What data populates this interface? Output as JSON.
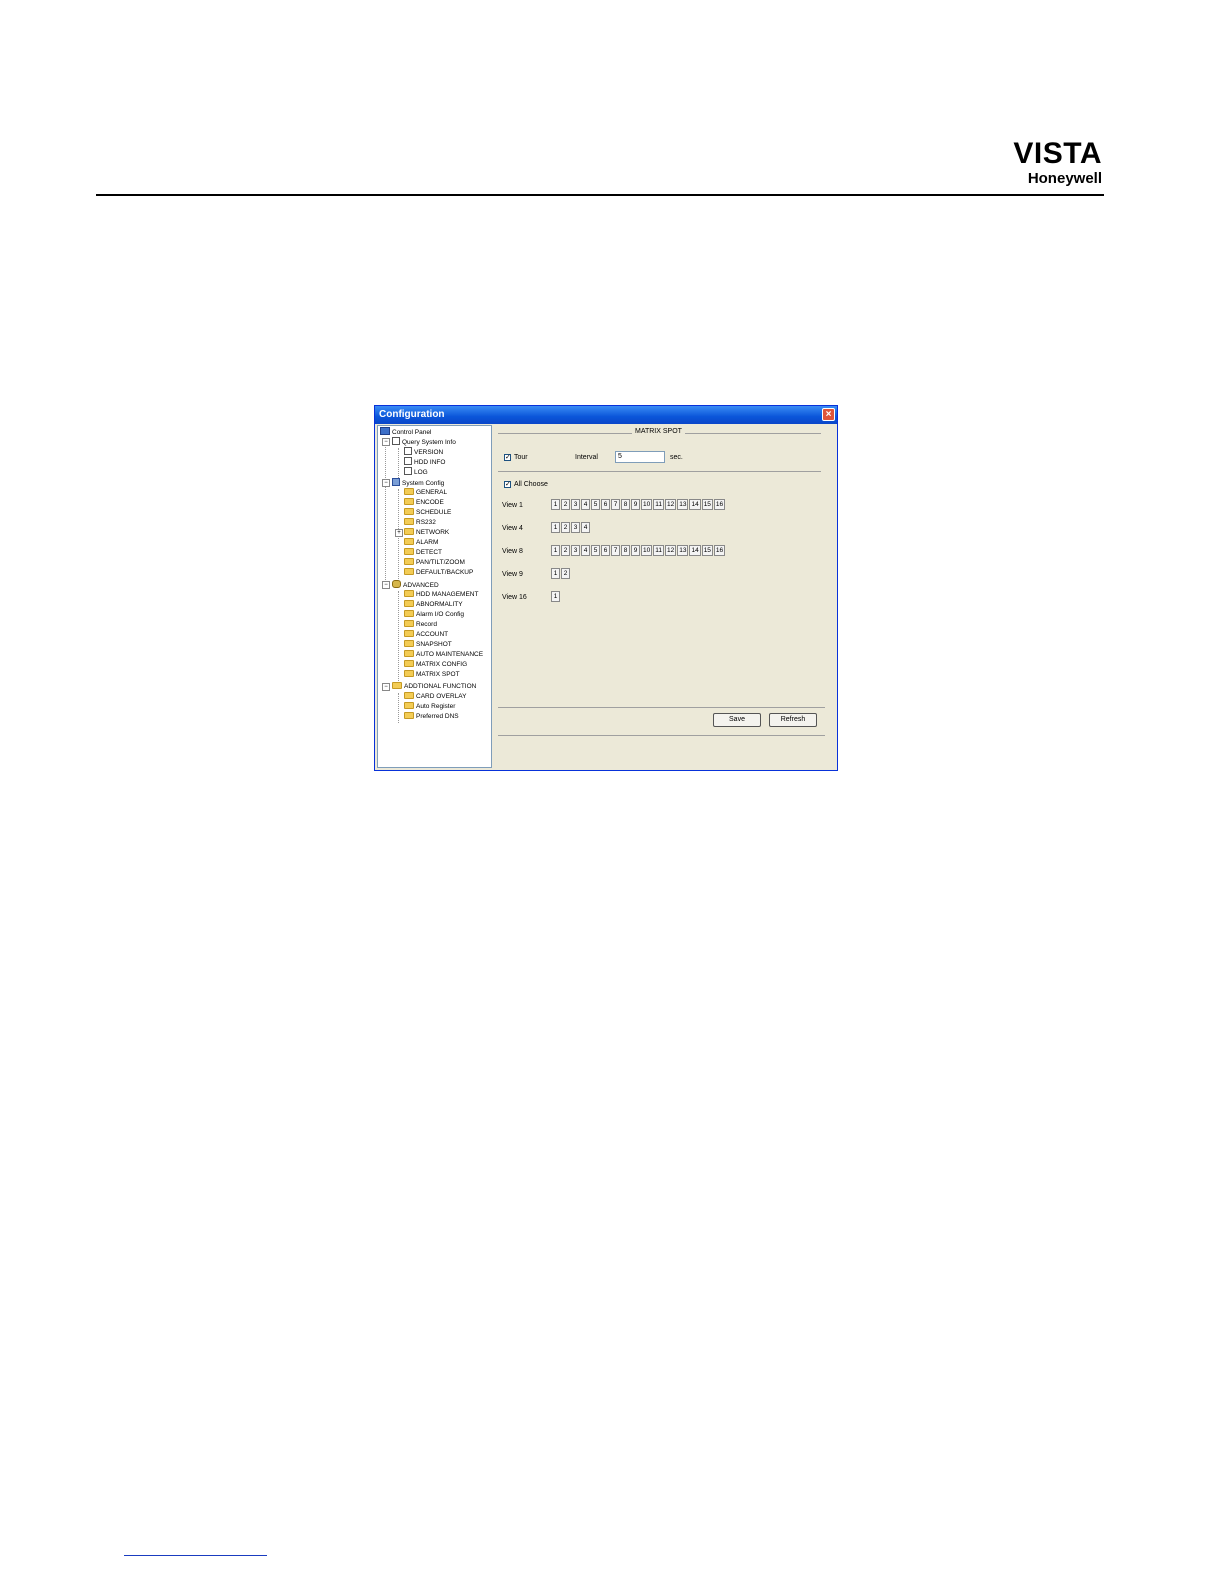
{
  "page": {
    "brand_name": "VISTA",
    "brand_company": "Honeywell"
  },
  "window": {
    "title": "Configuration",
    "close_glyph": "×"
  },
  "tree": {
    "control_panel": "Control Panel",
    "query_system_info": "Query System Info",
    "version": "VERSION",
    "hdd_info": "HDD INFO",
    "log": "LOG",
    "system_config": "System Config",
    "general": "GENERAL",
    "encode": "ENCODE",
    "schedule": "SCHEDULE",
    "rs232": "RS232",
    "network": "NETWORK",
    "alarm": "ALARM",
    "detect": "DETECT",
    "ptz": "PAN/TILT/ZOOM",
    "default_backup": "DEFAULT/BACKUP",
    "advanced": "ADVANCED",
    "hdd_management": "HDD MANAGEMENT",
    "abnormality": "ABNORMALITY",
    "alarm_io": "Alarm I/O Config",
    "record": "Record",
    "account": "ACCOUNT",
    "snapshot": "SNAPSHOT",
    "auto_maintenance": "AUTO MAINTENANCE",
    "matrix_config": "MATRIX CONFIG",
    "matrix_spot": "MATRIX SPOT",
    "additional_function": "ADDTIONAL FUNCTION",
    "card_overlay": "CARD OVERLAY",
    "auto_register": "Auto Register",
    "preferred_dns": "Preferred DNS",
    "toggle_minus": "−",
    "toggle_plus": "+"
  },
  "main": {
    "title": "MATRIX SPOT",
    "tour_checked": true,
    "tour_label": "Tour",
    "interval_label": "Interval",
    "interval_value": "5",
    "interval_unit": "sec.",
    "all_choose_checked": true,
    "all_choose_label": "All Choose",
    "check_mark": "✓",
    "view1_label": "View 1",
    "view1_cells": [
      "1",
      "2",
      "3",
      "4",
      "5",
      "6",
      "7",
      "8",
      "9",
      "10",
      "11",
      "12",
      "13",
      "14",
      "15",
      "16"
    ],
    "view4_label": "View 4",
    "view4_cells": [
      "1",
      "2",
      "3",
      "4"
    ],
    "view8_label": "View 8",
    "view8_cells": [
      "1",
      "2",
      "3",
      "4",
      "5",
      "6",
      "7",
      "8",
      "9",
      "10",
      "11",
      "12",
      "13",
      "14",
      "15",
      "16"
    ],
    "view9_label": "View 9",
    "view9_cells": [
      "1",
      "2"
    ],
    "view16_label": "View 16",
    "view16_cells": [
      "1"
    ],
    "save_label": "Save",
    "refresh_label": "Refresh"
  }
}
